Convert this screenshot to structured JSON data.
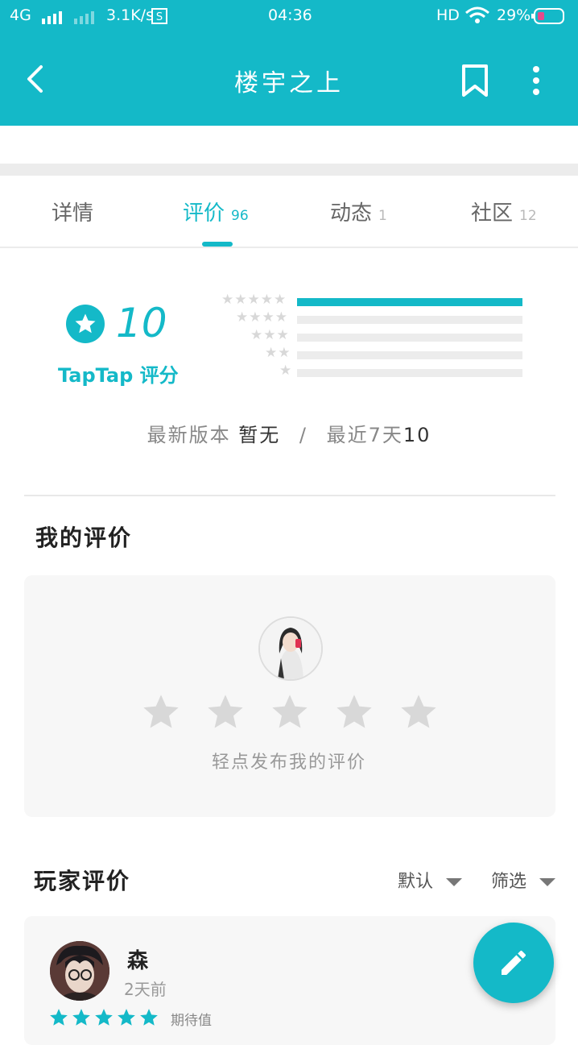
{
  "status_bar": {
    "network": "4G",
    "speed": "3.1K/s",
    "time": "04:36",
    "hd": "HD",
    "battery": "29%"
  },
  "header": {
    "title": "楼宇之上",
    "icons": [
      "back-arrow-icon",
      "bookmark-icon",
      "more-vertical-icon"
    ]
  },
  "tabs": [
    {
      "label": "详情",
      "count": ""
    },
    {
      "label": "评价",
      "count": "96"
    },
    {
      "label": "动态",
      "count": "1"
    },
    {
      "label": "社区",
      "count": "12"
    }
  ],
  "rating": {
    "score": "10",
    "label": "TapTap 评分",
    "distribution": [
      {
        "stars": 5,
        "fraction": 1.0
      },
      {
        "stars": 4,
        "fraction": 0.0
      },
      {
        "stars": 3,
        "fraction": 0.0
      },
      {
        "stars": 2,
        "fraction": 0.0
      },
      {
        "stars": 1,
        "fraction": 0.0
      }
    ],
    "latest_version_label": "最新版本",
    "latest_version_value": "暂无",
    "separator": "/",
    "recent_label": "最近7天",
    "recent_value": "10"
  },
  "my_review": {
    "title": "我的评价",
    "hint": "轻点发布我的评价",
    "star_count": 5
  },
  "player_reviews": {
    "title": "玩家评价",
    "sort_label": "默认",
    "filter_label": "筛选",
    "items": [
      {
        "user": "森",
        "time": "2天前",
        "stars": 5,
        "tag": "期待值"
      }
    ]
  },
  "colors": {
    "accent": "#14b9c8",
    "star_empty": "#d8d8d8"
  }
}
